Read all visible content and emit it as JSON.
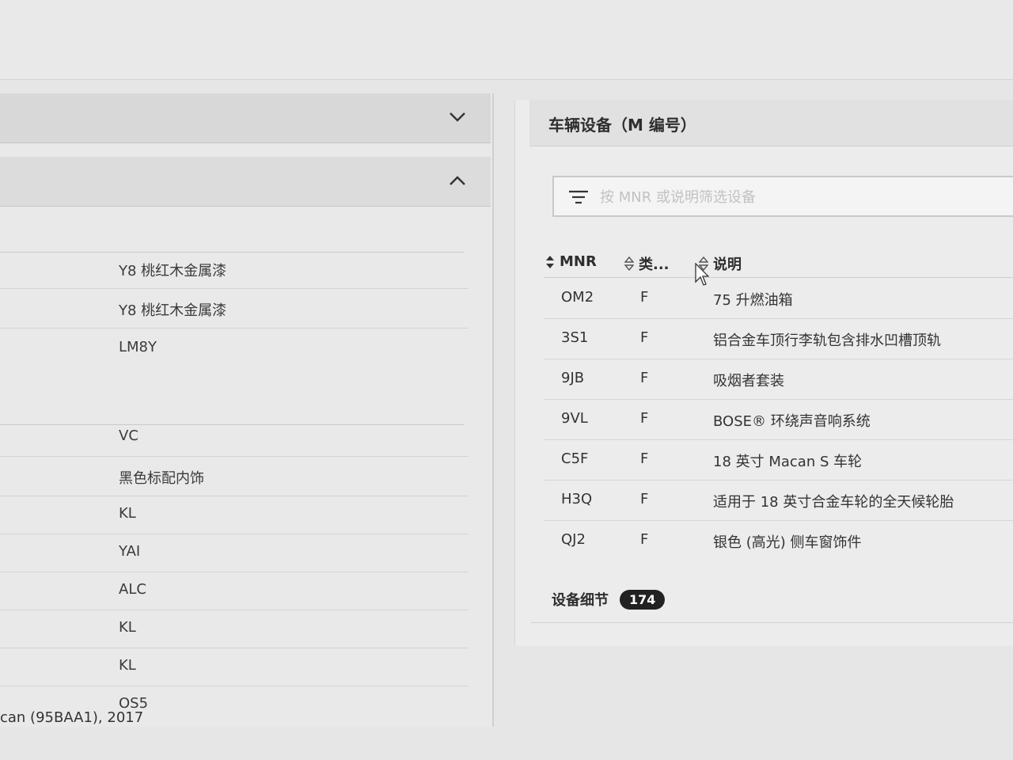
{
  "right_panel": {
    "title": "车辆设备（M 编号）",
    "filter": {
      "placeholder": "按 MNR 或说明筛选设备",
      "value": ""
    },
    "columns": {
      "mnr": "MNR",
      "type": "类...",
      "description": "说明"
    },
    "rows": [
      {
        "mnr": "OM2",
        "type": "F",
        "description": "75 升燃油箱"
      },
      {
        "mnr": "3S1",
        "type": "F",
        "description": "铝合金车顶行李轨包含排水凹槽顶轨"
      },
      {
        "mnr": "9JB",
        "type": "F",
        "description": "吸烟者套装"
      },
      {
        "mnr": "9VL",
        "type": "F",
        "description": "BOSE® 环绕声音响系统"
      },
      {
        "mnr": "C5F",
        "type": "F",
        "description": "18 英寸 Macan S 车轮"
      },
      {
        "mnr": "H3Q",
        "type": "F",
        "description": "适用于 18 英寸合金车轮的全天候轮胎"
      },
      {
        "mnr": "QJ2",
        "type": "F",
        "description": "银色 (高光) 侧车窗饰件"
      }
    ],
    "details": {
      "label": "设备细节",
      "count": "174"
    }
  },
  "left_panel": {
    "values": [
      "Y8 桃红木金属漆",
      "Y8 桃红木金属漆",
      "LM8Y",
      "VC",
      "黑色标配内饰",
      "KL",
      "YAI",
      "ALC",
      "KL",
      "KL",
      "OS5"
    ],
    "footer": "can (95BAA1), 2017"
  },
  "icons": {
    "collapse": "chevron-down-icon",
    "expand": "chevron-up-icon",
    "filter": "filter-icon",
    "sort": "sort-icon",
    "cursor": "mouse-cursor-icon"
  }
}
